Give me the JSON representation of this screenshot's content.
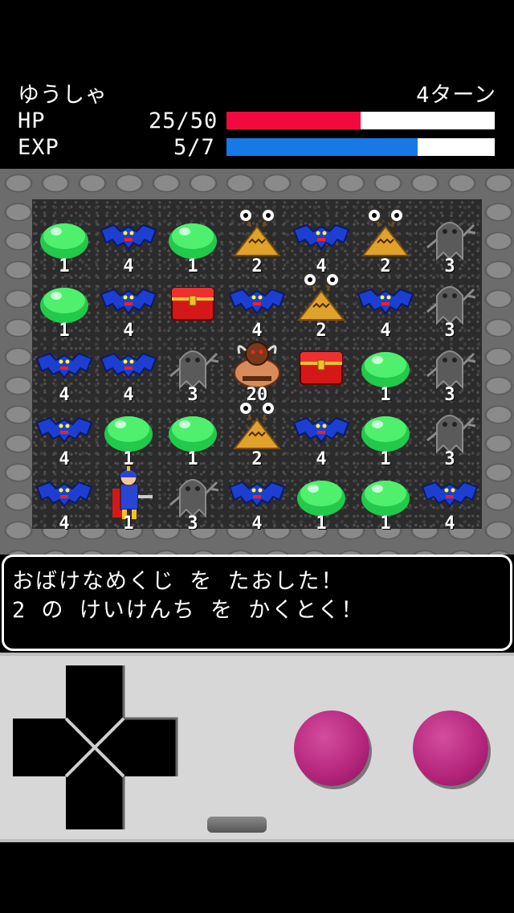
{
  "hero": {
    "name": "ゆうしゃ",
    "turns": "4ターン",
    "hp_label": "HP",
    "hp_value": "25/50",
    "hp_ratio": 0.5,
    "exp_label": "EXP",
    "exp_value": "5/7",
    "exp_ratio": 0.714,
    "hp_color": "#f20a3e",
    "exp_color": "#1779e8"
  },
  "board": {
    "cols": 7,
    "rows": 5,
    "cells": [
      {
        "type": "slime",
        "num": "1"
      },
      {
        "type": "bat",
        "num": "4"
      },
      {
        "type": "slime",
        "num": "1"
      },
      {
        "type": "snail",
        "num": "2"
      },
      {
        "type": "bat",
        "num": "4"
      },
      {
        "type": "snail",
        "num": "2"
      },
      {
        "type": "ghost",
        "num": "3"
      },
      {
        "type": "slime",
        "num": "1"
      },
      {
        "type": "bat",
        "num": "4"
      },
      {
        "type": "chest",
        "num": ""
      },
      {
        "type": "bat",
        "num": "4"
      },
      {
        "type": "snail",
        "num": "2"
      },
      {
        "type": "bat",
        "num": "4"
      },
      {
        "type": "ghost",
        "num": "3"
      },
      {
        "type": "bat",
        "num": "4"
      },
      {
        "type": "bat",
        "num": "4"
      },
      {
        "type": "ghost",
        "num": "3"
      },
      {
        "type": "minotaur",
        "num": "20"
      },
      {
        "type": "chest",
        "num": ""
      },
      {
        "type": "slime",
        "num": "1"
      },
      {
        "type": "ghost",
        "num": "3"
      },
      {
        "type": "bat",
        "num": "4"
      },
      {
        "type": "slime",
        "num": "1"
      },
      {
        "type": "slime",
        "num": "1"
      },
      {
        "type": "snail",
        "num": "2"
      },
      {
        "type": "bat",
        "num": "4"
      },
      {
        "type": "slime",
        "num": "1"
      },
      {
        "type": "ghost",
        "num": "3"
      },
      {
        "type": "bat",
        "num": "4"
      },
      {
        "type": "hero",
        "num": "1"
      },
      {
        "type": "ghost",
        "num": "3"
      },
      {
        "type": "bat",
        "num": "4"
      },
      {
        "type": "slime",
        "num": "1"
      },
      {
        "type": "slime",
        "num": "1"
      },
      {
        "type": "bat",
        "num": "4"
      }
    ]
  },
  "message": {
    "line1": "おばけなめくじ を たおした！",
    "line2": "2 の けいけんち を かくとく！"
  },
  "controller": {
    "button_color": "#b3247b"
  }
}
